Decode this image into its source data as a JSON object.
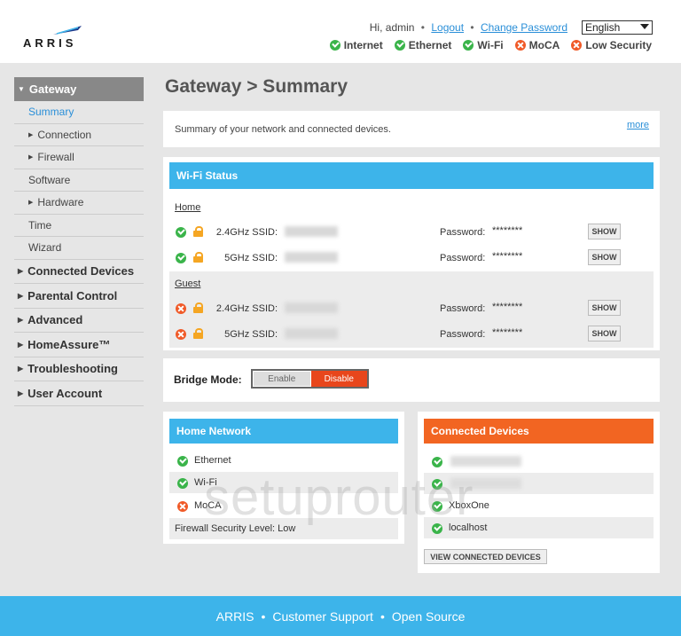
{
  "brand": {
    "logo_text": "ARRIS"
  },
  "header": {
    "greeting": "Hi, admin",
    "logout": "Logout",
    "change_password": "Change Password",
    "language": "English",
    "status": [
      {
        "label": "Internet",
        "state": "ok"
      },
      {
        "label": "Ethernet",
        "state": "ok"
      },
      {
        "label": "Wi-Fi",
        "state": "ok"
      },
      {
        "label": "MoCA",
        "state": "bad"
      },
      {
        "label": "Low Security",
        "state": "bad"
      }
    ]
  },
  "sidebar": {
    "gateway": "Gateway",
    "gateway_sub": [
      "Summary",
      "Connection",
      "Firewall",
      "Software",
      "Hardware",
      "Time",
      "Wizard"
    ],
    "items": [
      "Connected Devices",
      "Parental Control",
      "Advanced",
      "HomeAssure™",
      "Troubleshooting",
      "User Account"
    ]
  },
  "page": {
    "title": "Gateway > Summary",
    "intro": "Summary of your network and connected devices.",
    "more": "more"
  },
  "wifi": {
    "title": "Wi-Fi Status",
    "home_label": "Home",
    "guest_label": "Guest",
    "band_24": "2.4GHz SSID:",
    "band_5": "5GHz SSID:",
    "password_label": "Password:",
    "password_mask": "********",
    "show": "SHOW"
  },
  "bridge": {
    "label": "Bridge Mode:",
    "enable": "Enable",
    "disable": "Disable",
    "selected": "Disable"
  },
  "home_network": {
    "title": "Home Network",
    "items": [
      {
        "label": "Ethernet",
        "state": "ok"
      },
      {
        "label": "Wi-Fi",
        "state": "ok"
      },
      {
        "label": "MoCA",
        "state": "bad"
      }
    ],
    "firewall_label": "Firewall Security Level:",
    "firewall_value": "Low"
  },
  "connected_devices": {
    "title": "Connected Devices",
    "devices": [
      "XboxOne",
      "localhost"
    ],
    "view_button": "VIEW CONNECTED DEVICES"
  },
  "watermark": "setuprouter",
  "footer": {
    "arris": "ARRIS",
    "support": "Customer Support",
    "open_source": "Open Source"
  },
  "colors": {
    "accent_blue": "#3db4ea",
    "accent_orange": "#f26522",
    "ok_green": "#3ab44a",
    "bad_red": "#f05a28"
  }
}
